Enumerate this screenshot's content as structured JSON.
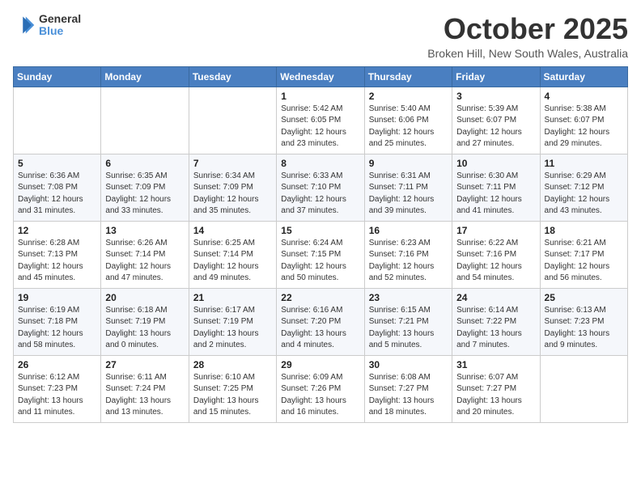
{
  "header": {
    "logo_general": "General",
    "logo_blue": "Blue",
    "month_title": "October 2025",
    "location": "Broken Hill, New South Wales, Australia"
  },
  "days_of_week": [
    "Sunday",
    "Monday",
    "Tuesday",
    "Wednesday",
    "Thursday",
    "Friday",
    "Saturday"
  ],
  "weeks": [
    [
      {
        "day": "",
        "info": ""
      },
      {
        "day": "",
        "info": ""
      },
      {
        "day": "",
        "info": ""
      },
      {
        "day": "1",
        "info": "Sunrise: 5:42 AM\nSunset: 6:05 PM\nDaylight: 12 hours\nand 23 minutes."
      },
      {
        "day": "2",
        "info": "Sunrise: 5:40 AM\nSunset: 6:06 PM\nDaylight: 12 hours\nand 25 minutes."
      },
      {
        "day": "3",
        "info": "Sunrise: 5:39 AM\nSunset: 6:07 PM\nDaylight: 12 hours\nand 27 minutes."
      },
      {
        "day": "4",
        "info": "Sunrise: 5:38 AM\nSunset: 6:07 PM\nDaylight: 12 hours\nand 29 minutes."
      }
    ],
    [
      {
        "day": "5",
        "info": "Sunrise: 6:36 AM\nSunset: 7:08 PM\nDaylight: 12 hours\nand 31 minutes."
      },
      {
        "day": "6",
        "info": "Sunrise: 6:35 AM\nSunset: 7:09 PM\nDaylight: 12 hours\nand 33 minutes."
      },
      {
        "day": "7",
        "info": "Sunrise: 6:34 AM\nSunset: 7:09 PM\nDaylight: 12 hours\nand 35 minutes."
      },
      {
        "day": "8",
        "info": "Sunrise: 6:33 AM\nSunset: 7:10 PM\nDaylight: 12 hours\nand 37 minutes."
      },
      {
        "day": "9",
        "info": "Sunrise: 6:31 AM\nSunset: 7:11 PM\nDaylight: 12 hours\nand 39 minutes."
      },
      {
        "day": "10",
        "info": "Sunrise: 6:30 AM\nSunset: 7:11 PM\nDaylight: 12 hours\nand 41 minutes."
      },
      {
        "day": "11",
        "info": "Sunrise: 6:29 AM\nSunset: 7:12 PM\nDaylight: 12 hours\nand 43 minutes."
      }
    ],
    [
      {
        "day": "12",
        "info": "Sunrise: 6:28 AM\nSunset: 7:13 PM\nDaylight: 12 hours\nand 45 minutes."
      },
      {
        "day": "13",
        "info": "Sunrise: 6:26 AM\nSunset: 7:14 PM\nDaylight: 12 hours\nand 47 minutes."
      },
      {
        "day": "14",
        "info": "Sunrise: 6:25 AM\nSunset: 7:14 PM\nDaylight: 12 hours\nand 49 minutes."
      },
      {
        "day": "15",
        "info": "Sunrise: 6:24 AM\nSunset: 7:15 PM\nDaylight: 12 hours\nand 50 minutes."
      },
      {
        "day": "16",
        "info": "Sunrise: 6:23 AM\nSunset: 7:16 PM\nDaylight: 12 hours\nand 52 minutes."
      },
      {
        "day": "17",
        "info": "Sunrise: 6:22 AM\nSunset: 7:16 PM\nDaylight: 12 hours\nand 54 minutes."
      },
      {
        "day": "18",
        "info": "Sunrise: 6:21 AM\nSunset: 7:17 PM\nDaylight: 12 hours\nand 56 minutes."
      }
    ],
    [
      {
        "day": "19",
        "info": "Sunrise: 6:19 AM\nSunset: 7:18 PM\nDaylight: 12 hours\nand 58 minutes."
      },
      {
        "day": "20",
        "info": "Sunrise: 6:18 AM\nSunset: 7:19 PM\nDaylight: 13 hours\nand 0 minutes."
      },
      {
        "day": "21",
        "info": "Sunrise: 6:17 AM\nSunset: 7:19 PM\nDaylight: 13 hours\nand 2 minutes."
      },
      {
        "day": "22",
        "info": "Sunrise: 6:16 AM\nSunset: 7:20 PM\nDaylight: 13 hours\nand 4 minutes."
      },
      {
        "day": "23",
        "info": "Sunrise: 6:15 AM\nSunset: 7:21 PM\nDaylight: 13 hours\nand 5 minutes."
      },
      {
        "day": "24",
        "info": "Sunrise: 6:14 AM\nSunset: 7:22 PM\nDaylight: 13 hours\nand 7 minutes."
      },
      {
        "day": "25",
        "info": "Sunrise: 6:13 AM\nSunset: 7:23 PM\nDaylight: 13 hours\nand 9 minutes."
      }
    ],
    [
      {
        "day": "26",
        "info": "Sunrise: 6:12 AM\nSunset: 7:23 PM\nDaylight: 13 hours\nand 11 minutes."
      },
      {
        "day": "27",
        "info": "Sunrise: 6:11 AM\nSunset: 7:24 PM\nDaylight: 13 hours\nand 13 minutes."
      },
      {
        "day": "28",
        "info": "Sunrise: 6:10 AM\nSunset: 7:25 PM\nDaylight: 13 hours\nand 15 minutes."
      },
      {
        "day": "29",
        "info": "Sunrise: 6:09 AM\nSunset: 7:26 PM\nDaylight: 13 hours\nand 16 minutes."
      },
      {
        "day": "30",
        "info": "Sunrise: 6:08 AM\nSunset: 7:27 PM\nDaylight: 13 hours\nand 18 minutes."
      },
      {
        "day": "31",
        "info": "Sunrise: 6:07 AM\nSunset: 7:27 PM\nDaylight: 13 hours\nand 20 minutes."
      },
      {
        "day": "",
        "info": ""
      }
    ]
  ]
}
